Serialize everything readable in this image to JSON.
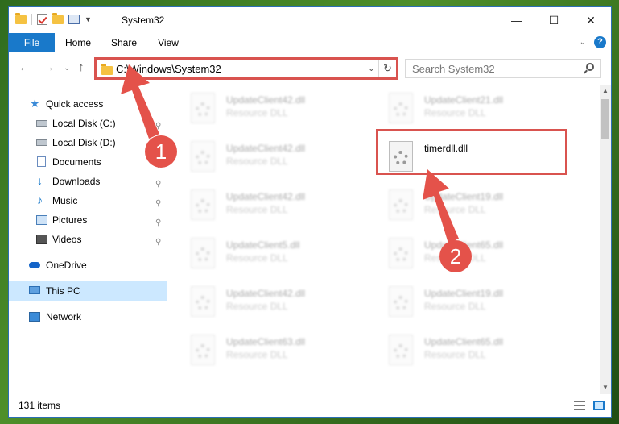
{
  "window": {
    "title": "System32",
    "controls": {
      "minimize": "—",
      "maximize": "☐",
      "close": "✕"
    }
  },
  "ribbon": {
    "tabs": [
      "File",
      "Home",
      "Share",
      "View"
    ],
    "collapse_glyph": "⌄",
    "help_glyph": "?"
  },
  "address": {
    "path": "C:\\Windows\\System32",
    "dropdown_glyph": "⌄",
    "refresh_glyph": "↻",
    "back_glyph": "←",
    "forward_glyph": "→",
    "recent_glyph": "⌄",
    "up_glyph": "↑"
  },
  "search": {
    "placeholder": "Search System32"
  },
  "navpane": {
    "items": [
      {
        "label": "Quick access",
        "icon": "star-icon"
      },
      {
        "label": "Local Disk (C:)",
        "icon": "disk-icon",
        "pinned": true
      },
      {
        "label": "Local Disk (D:)",
        "icon": "disk-icon"
      },
      {
        "label": "Documents",
        "icon": "document-icon",
        "pinned": true
      },
      {
        "label": "Downloads",
        "icon": "download-icon",
        "pinned": true
      },
      {
        "label": "Music",
        "icon": "music-icon",
        "pinned": true
      },
      {
        "label": "Pictures",
        "icon": "pictures-icon",
        "pinned": true
      },
      {
        "label": "Videos",
        "icon": "videos-icon",
        "pinned": true
      },
      {
        "label": "OneDrive",
        "icon": "onedrive-icon"
      },
      {
        "label": "This PC",
        "icon": "pc-icon",
        "selected": true
      },
      {
        "label": "Network",
        "icon": "network-icon"
      }
    ],
    "pin_glyph": "📌"
  },
  "files": [
    {
      "name": "UpdateClient42.dll",
      "type": "Resource DLL"
    },
    {
      "name": "UpdateClient21.dll",
      "type": "Resource DLL"
    },
    {
      "name": "UpdateClient42.dll",
      "type": "Resource DLL"
    },
    {
      "name": "timerdll.dll",
      "type": "",
      "highlighted": true
    },
    {
      "name": "UpdateClient42.dll",
      "type": "Resource DLL"
    },
    {
      "name": "UpdateClient19.dll",
      "type": "Resource DLL"
    },
    {
      "name": "UpdateClient5.dll",
      "type": "Resource DLL"
    },
    {
      "name": "UpdateClient65.dll",
      "type": "Resource DLL"
    },
    {
      "name": "UpdateClient42.dll",
      "type": "Resource DLL"
    },
    {
      "name": "UpdateClient19.dll",
      "type": "Resource DLL"
    },
    {
      "name": "UpdateClient63.dll",
      "type": "Resource DLL"
    },
    {
      "name": "UpdateClient65.dll",
      "type": "Resource DLL"
    }
  ],
  "status": {
    "item_count": "131 items"
  },
  "annotations": {
    "step1": "1",
    "step2": "2",
    "color": "#e4524a"
  }
}
